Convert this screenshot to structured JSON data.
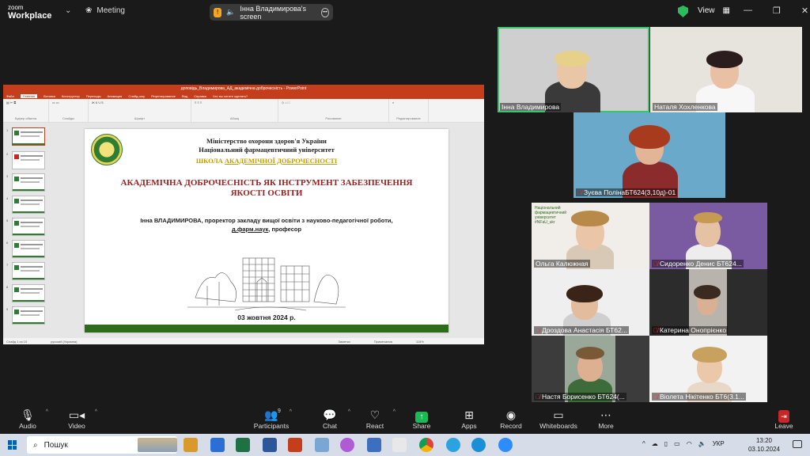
{
  "app": {
    "logo_line1": "zoom",
    "logo_line2": "Workplace",
    "meeting_label": "Meeting",
    "share_banner": "Інна Владимирова's screen",
    "view_label": "View"
  },
  "shared_screen": {
    "ppt_window_title": "доповідь_Владимирова_АД_академічна доброчесність - PowerPoint",
    "ppt_tabs": [
      "Файл",
      "Главная",
      "Вставка",
      "Конструктор",
      "Переходы",
      "Анимация",
      "Слайд-шоу",
      "Рецензирование",
      "Вид",
      "Справка",
      "Что вы хотите сделать?"
    ],
    "ppt_groups": [
      "Буфер обмена",
      "Слайды",
      "Шрифт",
      "Абзац",
      "Рисование",
      "Редактирование"
    ],
    "slide": {
      "ministry": "Міністерство охорони здоров'я України",
      "university": "Національний фармацевтичний університет",
      "school_prefix": "ШКОЛА ",
      "school_highlight": "АКАДЕМІЧНОЇ ДОБРОЧЕСНОСТІ",
      "title": "АКАДЕМІЧНА ДОБРОЧЕСНІСТЬ ЯК ІНСТРУМЕНТ ЗАБЕЗПЕЧЕННЯ ЯКОСТІ ОСВІТИ",
      "speaker_line1": "Інна ВЛАДИМИРОВА, проректор закладу вищої освіти з науково-педагогічної роботи,",
      "speaker_degree": "д.фарм.наук",
      "speaker_rank": ", професор",
      "date": "03 жовтня 2024 р."
    },
    "status_left": "Слайд 1 из 15",
    "status_lang": "русский (Украина)",
    "status_notes": "Заметки",
    "status_comments": "Примечания",
    "status_zoom": "116%"
  },
  "participants": [
    {
      "name": "Інна Владимирова",
      "muted": false,
      "speaking": true
    },
    {
      "name": "Наталя Хохленкова",
      "muted": false,
      "speaking": false
    },
    {
      "name": "Зуєва ПолінаБТ624(3,10д)-01",
      "muted": true,
      "speaking": false
    },
    {
      "name": "Ольга Калюжная",
      "muted": false,
      "speaking": false
    },
    {
      "name": "Сидоренко Денис  БТ624...",
      "muted": true,
      "speaking": false
    },
    {
      "name": "Дроздова Анастасія БТ62...",
      "muted": true,
      "speaking": false
    },
    {
      "name": "Катерина Онопрієнко",
      "muted": true,
      "speaking": false
    },
    {
      "name": "Настя Борисенко БТ624(...",
      "muted": true,
      "speaking": false
    },
    {
      "name": "Віолета Нікітенко БТ6(3.1...",
      "muted": true,
      "speaking": false
    }
  ],
  "tile_overlay_text": "Національний фармацевтичний університет",
  "tile_overlay_tag": "#NFaU_ukr",
  "toolbar": {
    "audio": "Audio",
    "video": "Video",
    "participants": "Participants",
    "participants_count": "9",
    "chat": "Chat",
    "react": "React",
    "share": "Share",
    "apps": "Apps",
    "record": "Record",
    "whiteboards": "Whiteboards",
    "more": "More",
    "leave": "Leave"
  },
  "taskbar": {
    "search_placeholder": "Пошук",
    "lang": "УКР",
    "time": "13:20",
    "date": "03.10.2024"
  },
  "colors": {
    "speaker_border": "#37c66b",
    "ppt_accent": "#c43e1c",
    "slide_title": "#9b1c1c",
    "school_text": "#c89b00",
    "slide_bar": "#2e6b1a",
    "muted_icon": "#e53935"
  }
}
